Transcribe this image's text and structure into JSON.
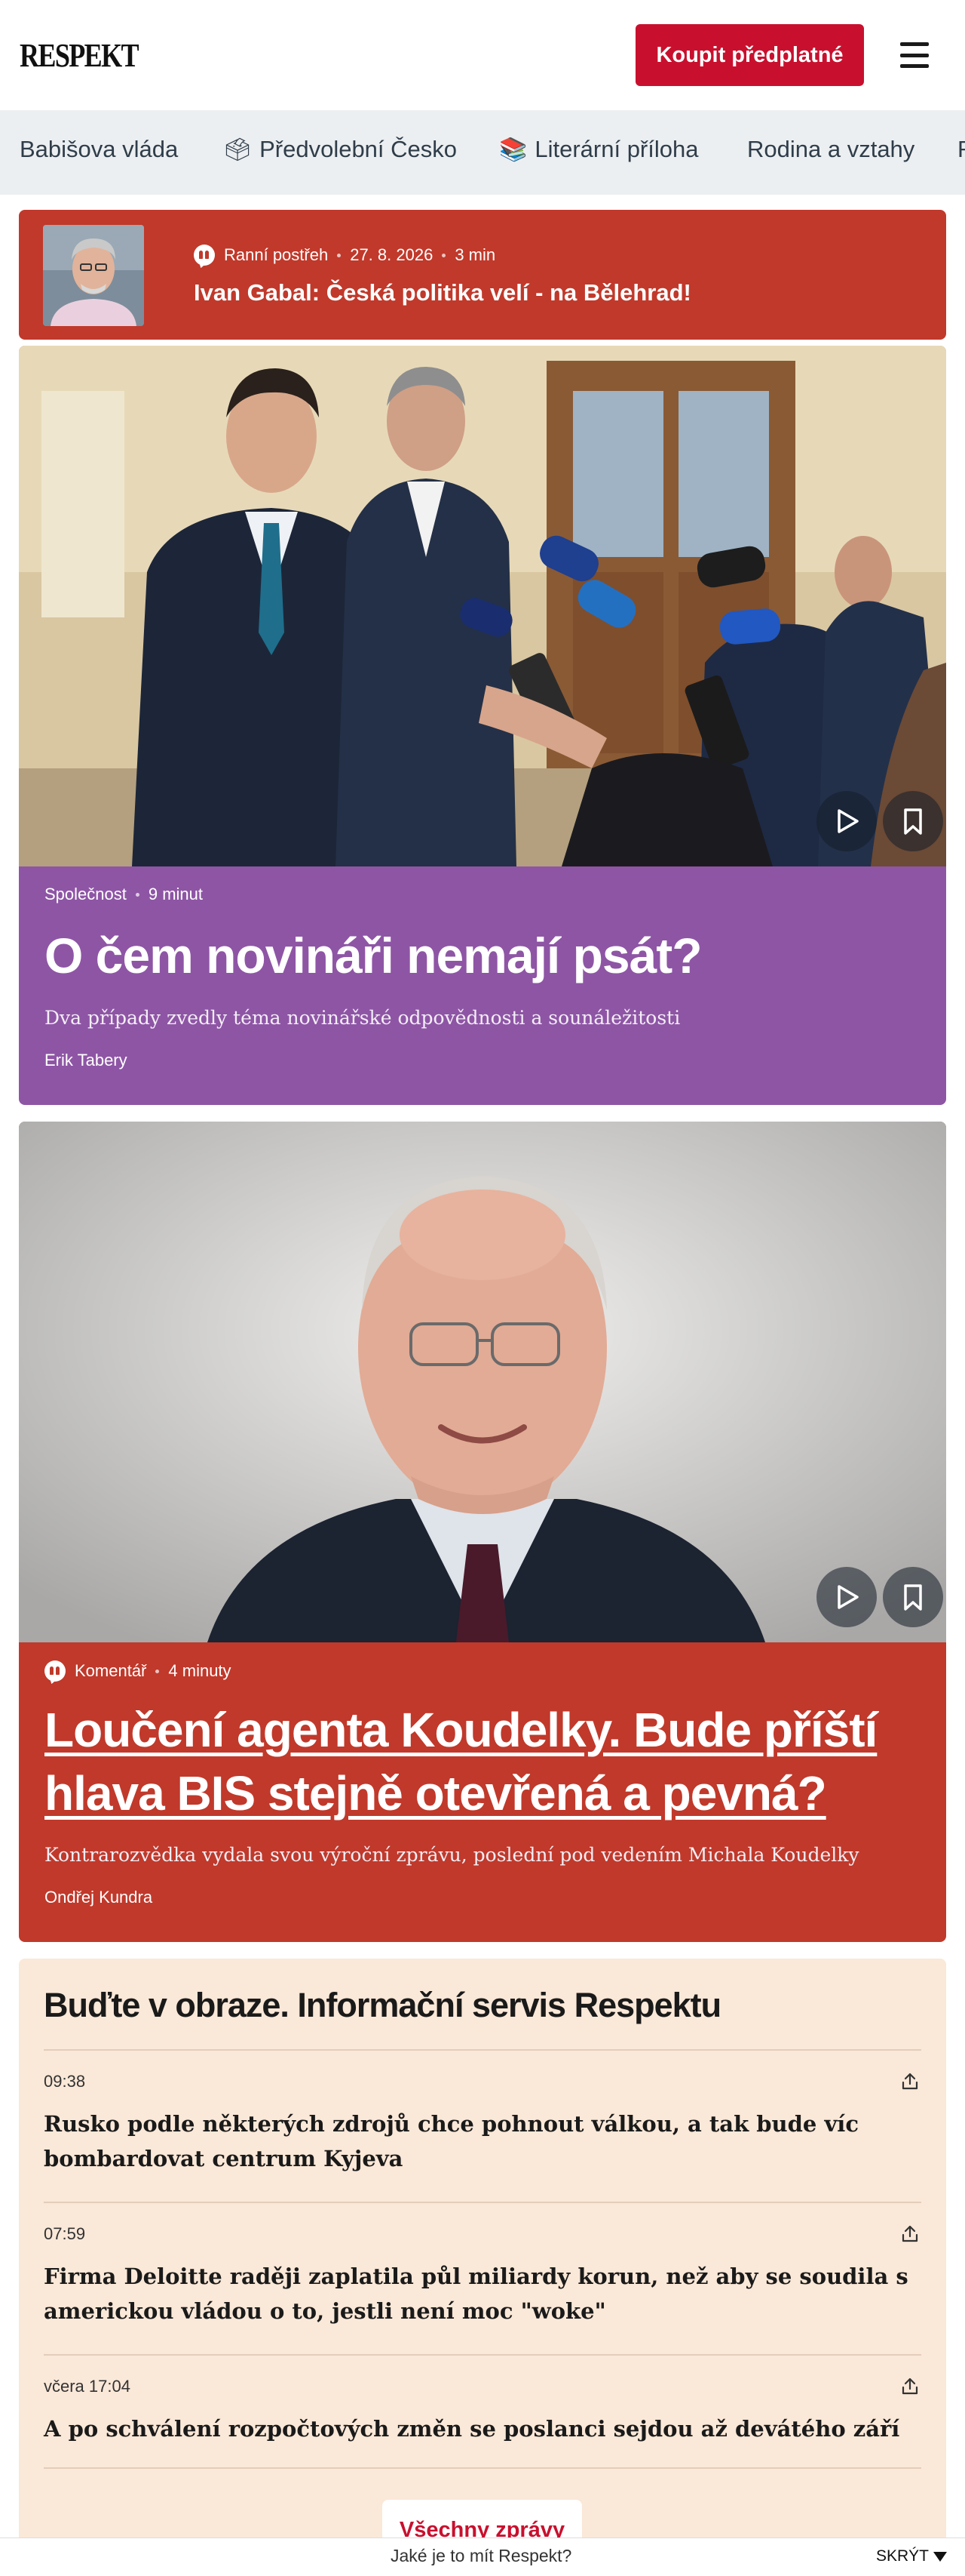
{
  "header": {
    "logo": "RESPEKT",
    "subscribe_label": "Koupit předplatné"
  },
  "categories": [
    {
      "label": "Babišova vláda",
      "emoji": ""
    },
    {
      "label": "Předvolební Česko",
      "emoji": "🗳"
    },
    {
      "label": "Literární příloha",
      "emoji": "📚"
    },
    {
      "label": "Rodina a vztahy",
      "emoji": ""
    }
  ],
  "breaking": {
    "section": "Ranní postřeh",
    "date": "27. 8. 2026",
    "read_time": "3 min",
    "headline": "Ivan Gabal: Česká politika velí - na Bělehrad!",
    "accent": "#c0392b"
  },
  "stories": [
    {
      "section": "Společnost",
      "read_time": "9 minut",
      "headline": "O čem novináři nemají psát?",
      "perex": "Dva případy zvedly téma novinářské odpovědnosti a sounáležitosti",
      "author": "Erik Tabery",
      "accent": "#8e55a5"
    },
    {
      "section": "Komentář",
      "read_time": "4 minuty",
      "headline": "Loučení agenta Koudelky. Bude příští hlava BIS stejně otevřená a pevná?",
      "perex": "Kontrarozvědka vydala svou výroční zprávu, poslední pod vedením Michala Koudelky",
      "author": "Ondřej Kundra",
      "accent": "#c0392b"
    }
  ],
  "news_service": {
    "title": "Buďte v obraze. Informační servis Respektu",
    "items": [
      {
        "time": "09:38",
        "title": "Rusko podle některých zdrojů chce pohnout válkou, a tak bude víc bombardovat centrum Kyjeva"
      },
      {
        "time": "07:59",
        "title": "Firma Deloitte raději zaplatila půl miliardy korun, než aby se soudila s americkou vládou o to, jestli není moc \"woke\""
      },
      {
        "time": "včera 17:04",
        "title": "A po schválení rozpočtových změn se poslanci sejdou až devátého září"
      }
    ],
    "all_label": "Všechny zprávy",
    "background": "#fae8d8"
  },
  "bottom_bar": {
    "question": "Jaké je to mít Respekt?",
    "hide_label": "SKRÝT"
  },
  "colors": {
    "brand_red": "#c8102e",
    "nav_bg": "#eceff1"
  }
}
